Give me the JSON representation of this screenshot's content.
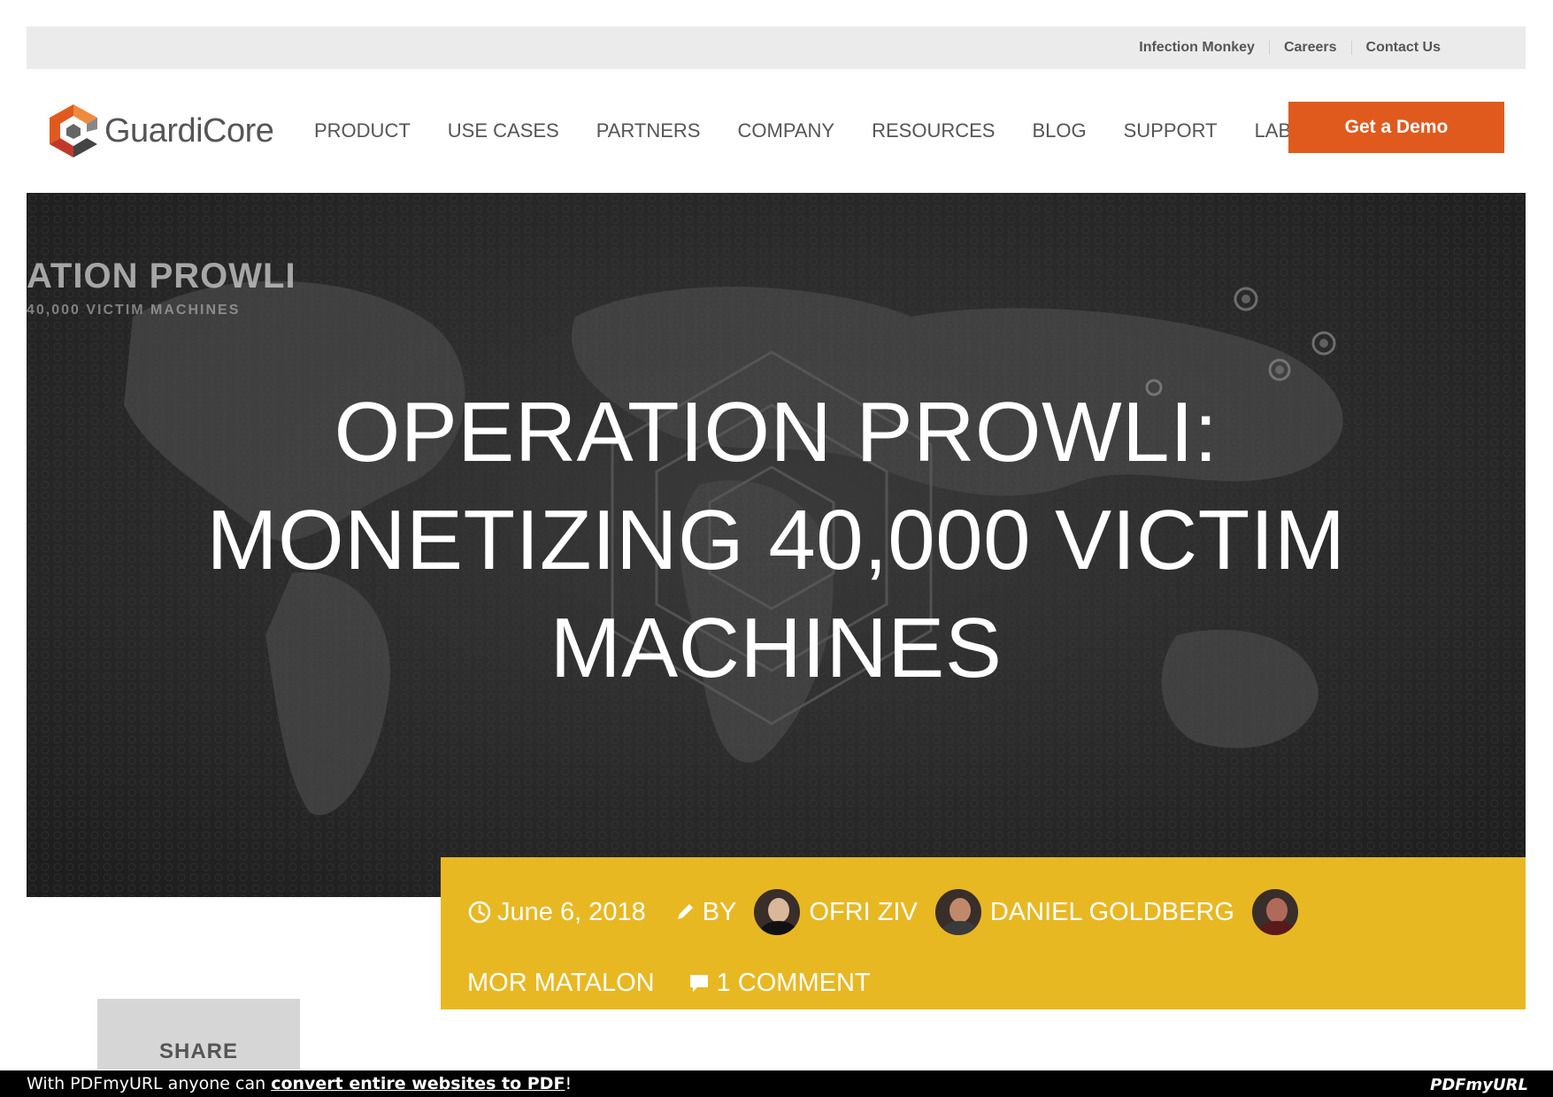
{
  "utility_nav": {
    "items": [
      "Infection Monkey",
      "Careers",
      "Contact Us"
    ]
  },
  "header": {
    "logo_text": "GuardiCore",
    "nav": [
      "PRODUCT",
      "USE CASES",
      "PARTNERS",
      "COMPANY",
      "RESOURCES",
      "BLOG",
      "SUPPORT",
      "LABS"
    ],
    "active_nav": "BLOG",
    "cta_label": "Get a Demo",
    "colors": {
      "cta": "#e05a1e",
      "nav_text": "#555555",
      "utility_bg": "#ebebeb"
    }
  },
  "hero": {
    "corner_title": "ATION  PROWLI",
    "corner_subtitle": "40,000 VICTIM MACHINES",
    "title_lines": [
      "OPERATION PROWLI:",
      "MONETIZING 40,000 VICTIM",
      "MACHINES"
    ]
  },
  "meta": {
    "date": "June 6, 2018",
    "by_label": "BY",
    "authors": [
      "OFRI ZIV",
      "DANIEL GOLDBERG",
      "MOR MATALON"
    ],
    "comments": "1 COMMENT",
    "bg_color": "#e8b823",
    "icons": {
      "date": "clock-icon",
      "author": "pencil-icon",
      "comments": "comment-icon"
    }
  },
  "share": {
    "label": "SHARE"
  },
  "pdf_footer": {
    "prefix": "With PDFmyURL anyone can ",
    "link_text": "convert entire websites to PDF",
    "suffix": "!",
    "logo": "PDFmyURL"
  }
}
